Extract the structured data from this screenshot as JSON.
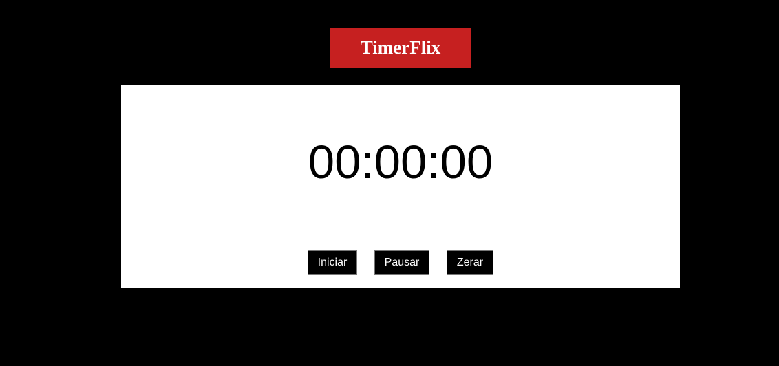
{
  "header": {
    "title": "TimerFlix"
  },
  "timer": {
    "display": "00:00:00"
  },
  "controls": {
    "start_label": "Iniciar",
    "pause_label": "Pausar",
    "reset_label": "Zerar"
  },
  "colors": {
    "background": "#000000",
    "brand": "#c62020",
    "panel": "#ffffff",
    "button_bg": "#000000",
    "button_text": "#ffffff"
  }
}
